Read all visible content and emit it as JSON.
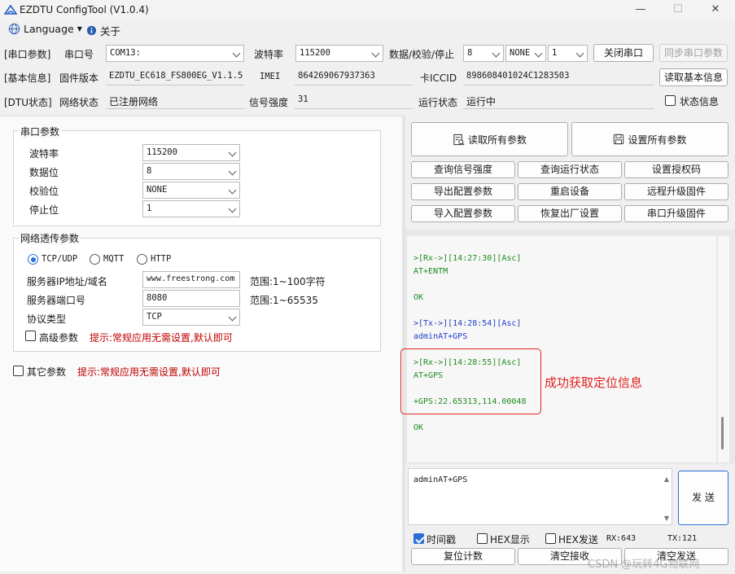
{
  "window": {
    "title": "EZDTU ConfigTool (V1.0.4)",
    "min_glyph": "—",
    "max_glyph": "☐",
    "close_glyph": "✕"
  },
  "menubar": {
    "language": "Language",
    "about": "关于"
  },
  "serial_row": {
    "tag": "[串口参数]",
    "port_label": "串口号",
    "port_value": "COM13:",
    "baud_label": "波特率",
    "baud_value": "115200",
    "dcs_label": "数据/校验/停止",
    "data_bits": "8",
    "parity": "NONE",
    "stop_bits": "1",
    "close_btn": "关闭串口",
    "sync_btn": "同步串口参数"
  },
  "info_row": {
    "tag": "[基本信息]",
    "fw_label": "固件版本",
    "fw_value": "EZDTU_EC618_FS800EG_V1.1.5",
    "imei_label": "IMEI",
    "imei_value": "864269067937363",
    "iccid_label": "卡ICCID",
    "iccid_value": "898608401024C1283503",
    "read_btn": "读取基本信息"
  },
  "dtu_row": {
    "tag": "[DTU状态]",
    "net_label": "网络状态",
    "net_value": "已注册网络",
    "signal_label": "信号强度",
    "signal_value": "31",
    "run_label": "运行状态",
    "run_value": "运行中",
    "status_info": "状态信息"
  },
  "serial_params": {
    "title": "串口参数",
    "rows": [
      {
        "label": "波特率",
        "value": "115200"
      },
      {
        "label": "数据位",
        "value": "8"
      },
      {
        "label": "校验位",
        "value": "NONE"
      },
      {
        "label": "停止位",
        "value": "1"
      }
    ]
  },
  "net_params": {
    "title": "网络透传参数",
    "protocols": [
      "TCP/UDP",
      "MQTT",
      "HTTP"
    ],
    "selected_protocol": "TCP/UDP",
    "server_label": "服务器IP地址/域名",
    "server_value": "www.freestrong.com",
    "server_range": "范围:1~100字符",
    "port_label": "服务器端口号",
    "port_value": "8080",
    "port_range": "范围:1~65535",
    "proto_label": "协议类型",
    "proto_value": "TCP",
    "advanced_label": "高级参数",
    "advanced_hint": "提示:常规应用无需设置,默认即可"
  },
  "other_params": {
    "label": "其它参数",
    "hint": "提示:常规应用无需设置,默认即可"
  },
  "actions": {
    "read_all": "读取所有参数",
    "set_all": "设置所有参数",
    "grid": [
      "查询信号强度",
      "查询运行状态",
      "设置授权码",
      "导出配置参数",
      "重启设备",
      "远程升级固件",
      "导入配置参数",
      "恢复出厂设置",
      "串口升级固件"
    ]
  },
  "console": {
    "lines": [
      {
        "text": ">[Rx->][14:27:30][Asc]",
        "kind": "green"
      },
      {
        "text": "AT+ENTM",
        "kind": "green"
      },
      {
        "text": "",
        "kind": "green"
      },
      {
        "text": "OK",
        "kind": "green"
      },
      {
        "text": "",
        "kind": "green"
      },
      {
        "text": ">[Tx->][14:28:54][Asc]",
        "kind": "blue"
      },
      {
        "text": "adminAT+GPS",
        "kind": "blue"
      },
      {
        "text": "",
        "kind": "green"
      },
      {
        "text": ">[Rx->][14:28:55][Asc]",
        "kind": "green"
      },
      {
        "text": "AT+GPS",
        "kind": "green"
      },
      {
        "text": "",
        "kind": "green"
      },
      {
        "text": "+GPS:22.65313,114.00048",
        "kind": "green"
      },
      {
        "text": "",
        "kind": "green"
      },
      {
        "text": "OK",
        "kind": "green"
      }
    ],
    "annotation": "成功获取定位信息",
    "annotation_color": "#e02020"
  },
  "send": {
    "input_value": "adminAT+GPS",
    "send_btn": "发 送"
  },
  "status_bar": {
    "timestamp_label": "时间戳",
    "timestamp_checked": true,
    "hex_display": "HEX显示",
    "hex_send": "HEX发送",
    "rx": "RX:643",
    "tx": "TX:121",
    "reset_count": "复位计数",
    "clear_recv": "清空接收",
    "clear_send": "清空发送"
  },
  "watermark": "CSDN @玩转4G物联网",
  "colors": {
    "accent": "#2a6fd6",
    "hint": "#c00000",
    "rx_text": "#1e8a1e",
    "tx_text": "#1f3fc8"
  }
}
